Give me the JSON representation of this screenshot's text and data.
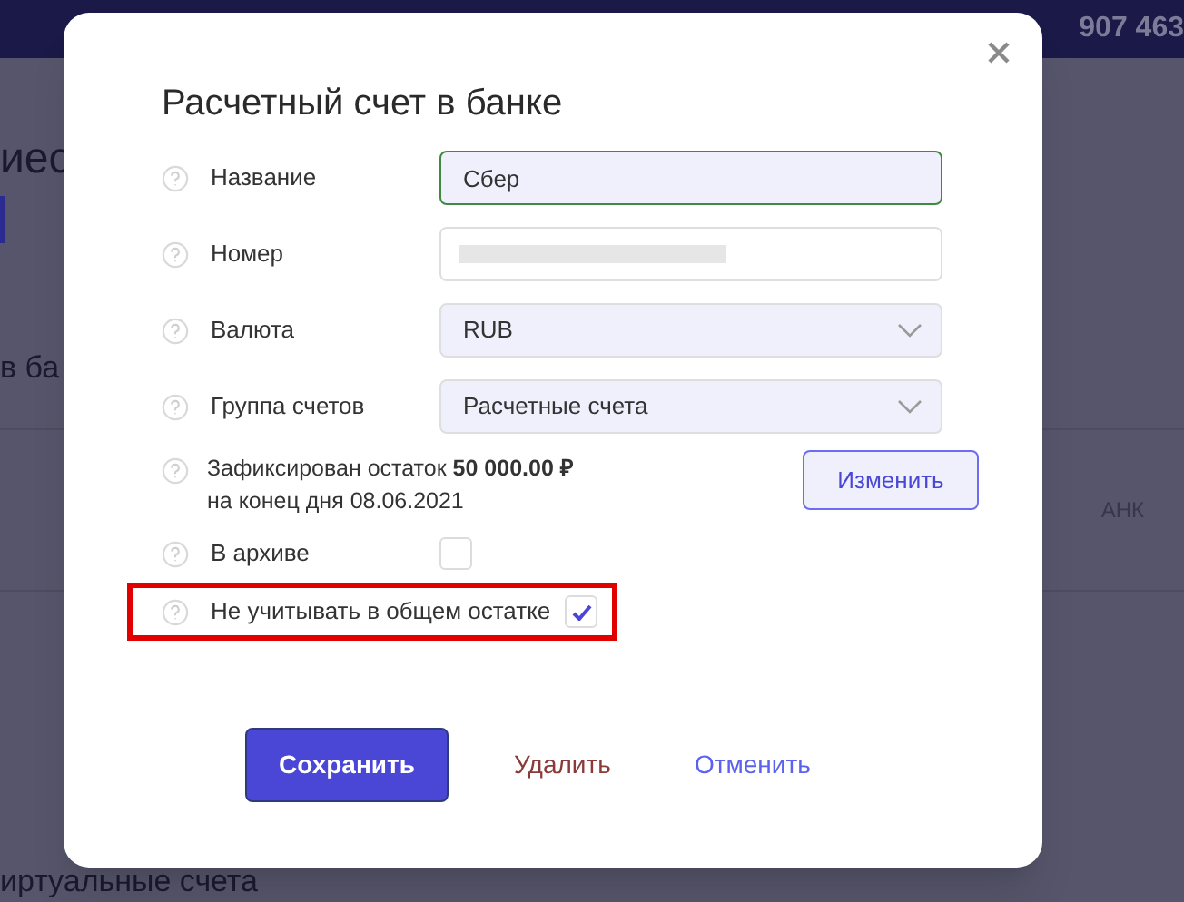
{
  "background": {
    "header": {
      "amount": "907 463"
    },
    "heading": "иес",
    "section": "в ба",
    "column": "АНК",
    "footer_section": "иртуальные счета"
  },
  "dialog": {
    "title": "Расчетный счет в банке",
    "fields": [
      {
        "kind": "text",
        "label": "Название",
        "value": "Сбер",
        "focused": true
      },
      {
        "kind": "redacted",
        "label": "Номер",
        "focused": false
      },
      {
        "kind": "select",
        "label": "Валюта",
        "value": "RUB",
        "focused": false
      },
      {
        "kind": "select",
        "label": "Группа счетов",
        "value": "Расчетные счета",
        "focused": false
      }
    ],
    "balance": {
      "text": "Зафиксирован остаток **50 000.00 ₽**",
      "date_text": "на конец дня 08.06.2021",
      "button": "Изменить"
    },
    "checkboxes": [
      {
        "label": "В архиве",
        "checked": false,
        "highlighted": false
      },
      {
        "label": "Не учитывать в общем остатке",
        "checked": true,
        "highlighted": true
      }
    ],
    "buttons": [
      {
        "kind": "primary",
        "label": "Сохранить"
      },
      {
        "kind": "danger",
        "label": "Удалить"
      },
      {
        "kind": "link",
        "label": "Отменить"
      }
    ]
  }
}
